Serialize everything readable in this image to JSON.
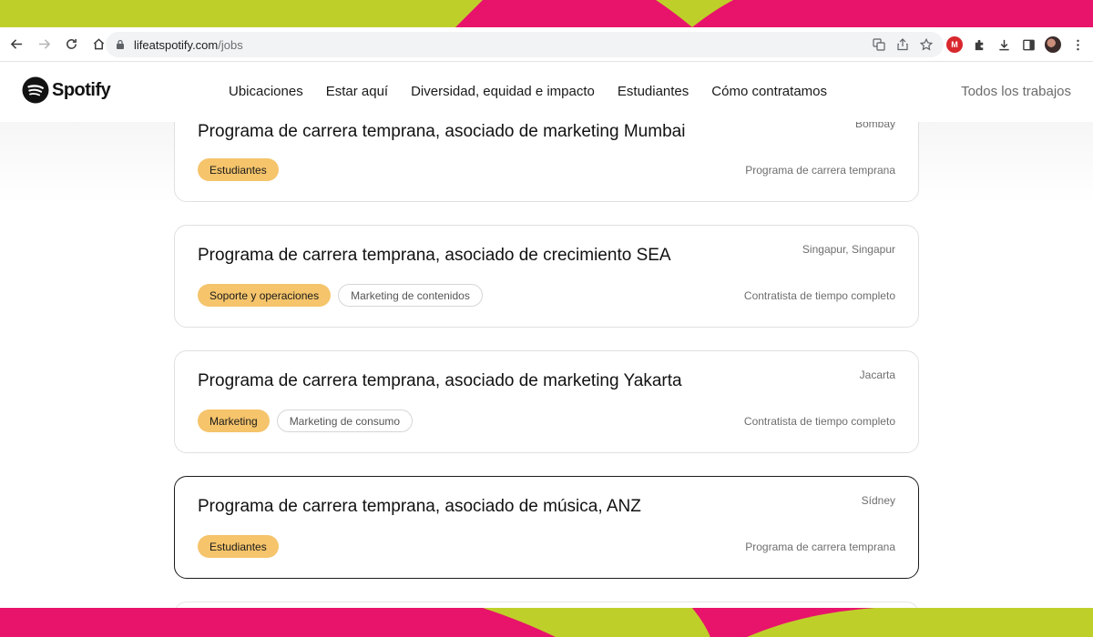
{
  "browser": {
    "url_domain": "lifeatspotify.com",
    "url_path": "/jobs",
    "mega_label": "M"
  },
  "header": {
    "logo_text": "Spotify",
    "nav": [
      {
        "label": "Ubicaciones"
      },
      {
        "label": "Estar aquí"
      },
      {
        "label": "Diversidad, equidad e impacto"
      },
      {
        "label": "Estudiantes"
      },
      {
        "label": "Cómo contratamos"
      }
    ],
    "all_jobs_label": "Todos los trabajos"
  },
  "jobs": [
    {
      "title": "Programa de carrera temprana, asociado de marketing Mumbai",
      "location": "Bombay",
      "tags": [
        {
          "label": "Estudiantes",
          "style": "primary"
        }
      ],
      "type": "Programa de carrera temprana"
    },
    {
      "title": "Programa de carrera temprana, asociado de crecimiento SEA",
      "location": "Singapur, Singapur",
      "tags": [
        {
          "label": "Soporte y operaciones",
          "style": "primary"
        },
        {
          "label": "Marketing de contenidos",
          "style": "secondary"
        }
      ],
      "type": "Contratista de tiempo completo"
    },
    {
      "title": "Programa de carrera temprana, asociado de marketing Yakarta",
      "location": "Jacarta",
      "tags": [
        {
          "label": "Marketing",
          "style": "primary"
        },
        {
          "label": "Marketing de consumo",
          "style": "secondary"
        }
      ],
      "type": "Contratista de tiempo completo"
    },
    {
      "title": "Programa de carrera temprana, asociado de música, ANZ",
      "location": "Sídney",
      "tags": [
        {
          "label": "Estudiantes",
          "style": "primary"
        }
      ],
      "type": "Programa de carrera temprana"
    }
  ],
  "colors": {
    "accent_pink": "#e8136b",
    "accent_lime": "#bfcf2a",
    "tag_primary": "#f5c46b"
  },
  "icons": [
    "back-arrow-icon",
    "forward-arrow-icon",
    "reload-icon",
    "home-icon",
    "lock-icon",
    "translate-icon",
    "share-icon",
    "star-icon",
    "mega-icon",
    "puzzle-icon",
    "download-icon",
    "sidepanel-icon",
    "avatar",
    "kebab-menu-icon",
    "spotify-logo-icon"
  ]
}
